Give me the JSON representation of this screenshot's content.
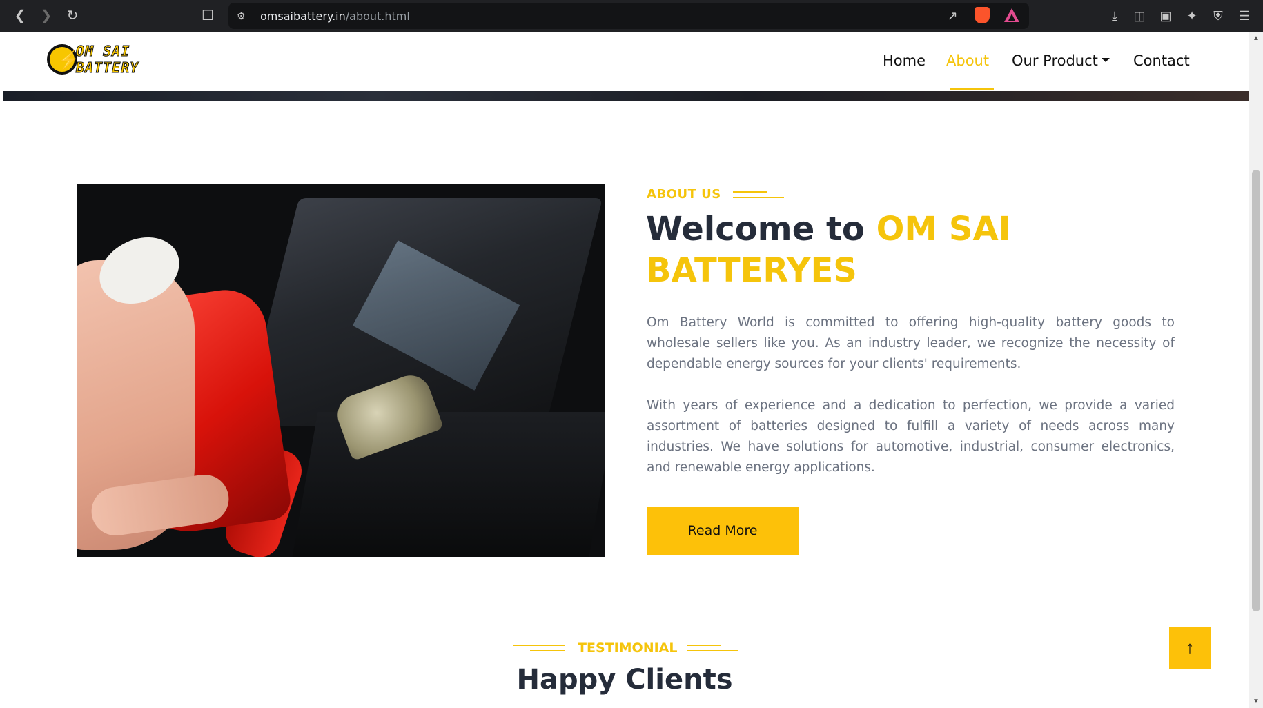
{
  "browser": {
    "url_domain": "omsaibattery.in",
    "url_path": "/about.html"
  },
  "logo": {
    "line1": "OM SAI",
    "line2": "BATTERY"
  },
  "nav": {
    "home": "Home",
    "about": "About",
    "product": "Our Product",
    "contact": "Contact"
  },
  "about": {
    "eyebrow": "ABOUT US",
    "heading_prefix": "Welcome to ",
    "heading_brand": "OM SAI BATTERYES",
    "paragraph1": "Om Battery World is committed to offering high-quality battery goods to wholesale sellers like you. As an industry leader, we recognize the necessity of dependable energy sources for your clients' requirements.",
    "paragraph2": "With years of experience and a dedication to perfection, we provide a varied assortment of batteries designed to fulfill a variety of needs across many industries. We have solutions for automotive, industrial, consumer electronics, and renewable energy applications.",
    "button": "Read More"
  },
  "testimonial": {
    "eyebrow": "TESTIMONIAL",
    "heading": "Happy Clients"
  },
  "colors": {
    "accent": "#f5c40b",
    "button": "#fdc109",
    "heading": "#252c3a",
    "body_text": "#6b7280"
  }
}
